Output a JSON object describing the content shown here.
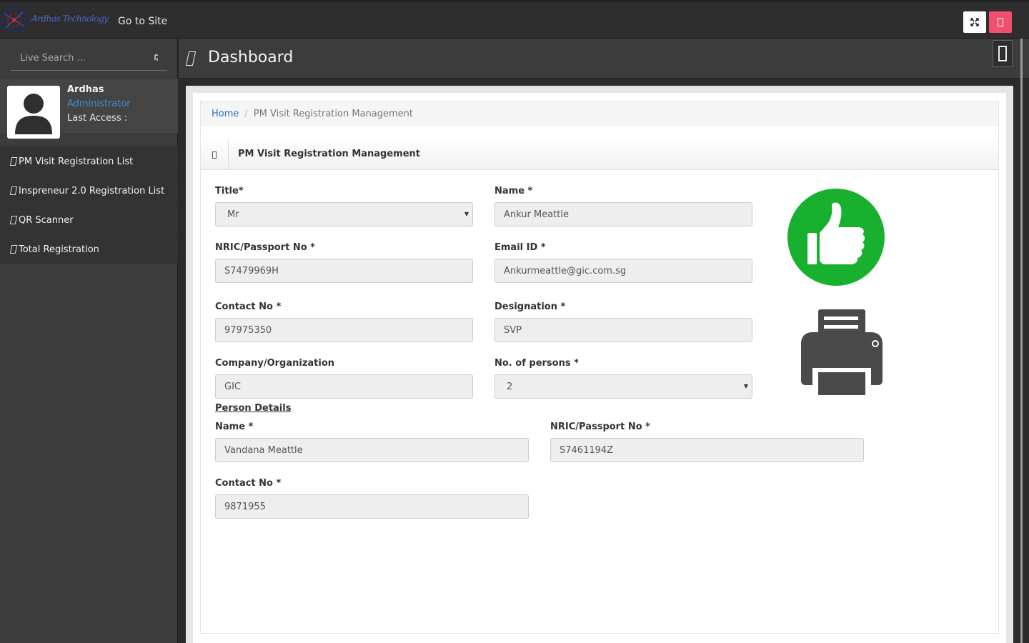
{
  "topbar": {
    "logo_text": "Ardhas Technology",
    "logo_tagline": "...",
    "goto_label": "Go to Site",
    "expand_icon": "expand-icon",
    "power_icon": "power-icon",
    "power_color": "#f0506e"
  },
  "sidebar": {
    "search_placeholder": "Live Search ...",
    "profile": {
      "name": "Ardhas",
      "role": "Administrator",
      "last_access": "Last Access :"
    },
    "items": [
      {
        "label": "PM Visit Registration List"
      },
      {
        "label": "Inspreneur 2.0 Registration List"
      },
      {
        "label": "QR Scanner"
      },
      {
        "label": "Total Registration"
      }
    ]
  },
  "header": {
    "title": "Dashboard"
  },
  "breadcrumb": {
    "home": "Home",
    "separator": "/",
    "current": "PM Visit Registration Management"
  },
  "section": {
    "title": "PM Visit Registration Management"
  },
  "form": {
    "title_label": "Title*",
    "title_value": "Mr",
    "name_label": "Name *",
    "name_value": "Ankur Meattle",
    "nric_label": "NRIC/Passport No *",
    "nric_value": "S7479969H",
    "email_label": "Email ID *",
    "email_value": "Ankurmeattle@gic.com.sg",
    "contact_label": "Contact No *",
    "contact_value": "97975350",
    "designation_label": "Designation *",
    "designation_value": "SVP",
    "company_label": "Company/Organization",
    "company_value": "GIC",
    "persons_label": "No. of persons *",
    "persons_value": "2"
  },
  "person_details": {
    "heading": "Person Details",
    "name_label": "Name *",
    "name_value": "Vandana Meattle",
    "nric_label": "NRIC/Passport No *",
    "nric_value": "S7461194Z",
    "contact_label": "Contact No *",
    "contact_value": "9871955"
  },
  "actions": {
    "approve_icon": "thumbs-up-icon",
    "approve_color": "#1ab02f",
    "print_icon": "printer-icon"
  }
}
